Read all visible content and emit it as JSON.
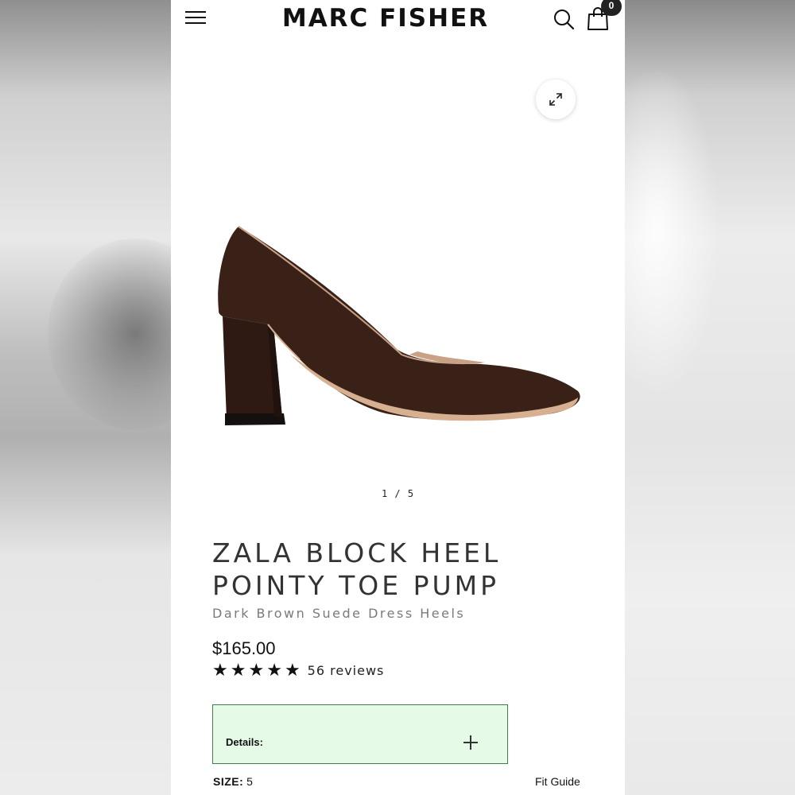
{
  "header": {
    "brand": "MARC FISHER",
    "cart_count": "0"
  },
  "gallery": {
    "counter": "1 / 5",
    "image_alt": "Dark brown suede block heel pump"
  },
  "product": {
    "title_line1": "ZALA BLOCK HEEL",
    "title_line2": "POINTY TOE PUMP",
    "subtitle": "Dark Brown Suede Dress Heels",
    "price": "$165.00",
    "rating": 5,
    "reviews": "56 reviews"
  },
  "details": {
    "label": "Details:"
  },
  "size": {
    "label": "SIZE:",
    "value": "5",
    "fit_guide": "Fit Guide"
  },
  "colors": {
    "details_bg": "#e6fbe7",
    "details_border": "#3f7f4a",
    "shoe": "#3a2117"
  }
}
